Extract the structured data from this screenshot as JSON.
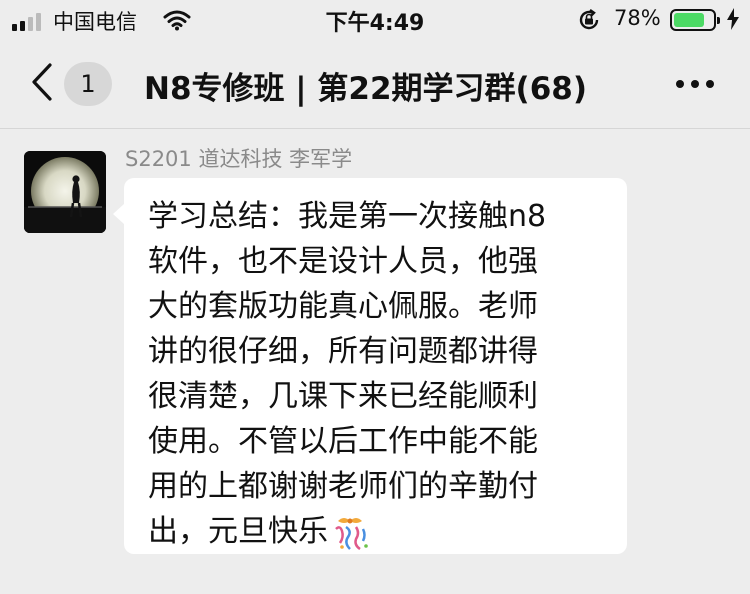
{
  "status_bar": {
    "carrier": "中国电信",
    "time": "下午4:49",
    "battery_percent": "78%",
    "battery_level": 0.78
  },
  "nav": {
    "unread_count": "1",
    "title": "N8专修班 | 第22期学习群(68)"
  },
  "message": {
    "sender": "S2201 道达科技 李军学",
    "lines": [
      "学习总结：我是第一次接触n8",
      "软件，也不是设计人员，他强",
      "大的套版功能真心佩服。老师",
      "讲的很仔细，所有问题都讲得",
      "很清楚，几课下来已经能顺利",
      "使用。不管以后工作中能不能",
      "用的上都谢谢老师们的辛勤付",
      "出，元旦快乐"
    ],
    "emoji": "party-popper-icon"
  },
  "colors": {
    "page_background": "#ededed",
    "bubble": "#ffffff",
    "battery_fill": "#4cd964",
    "sender_text": "#8a8a8a"
  }
}
